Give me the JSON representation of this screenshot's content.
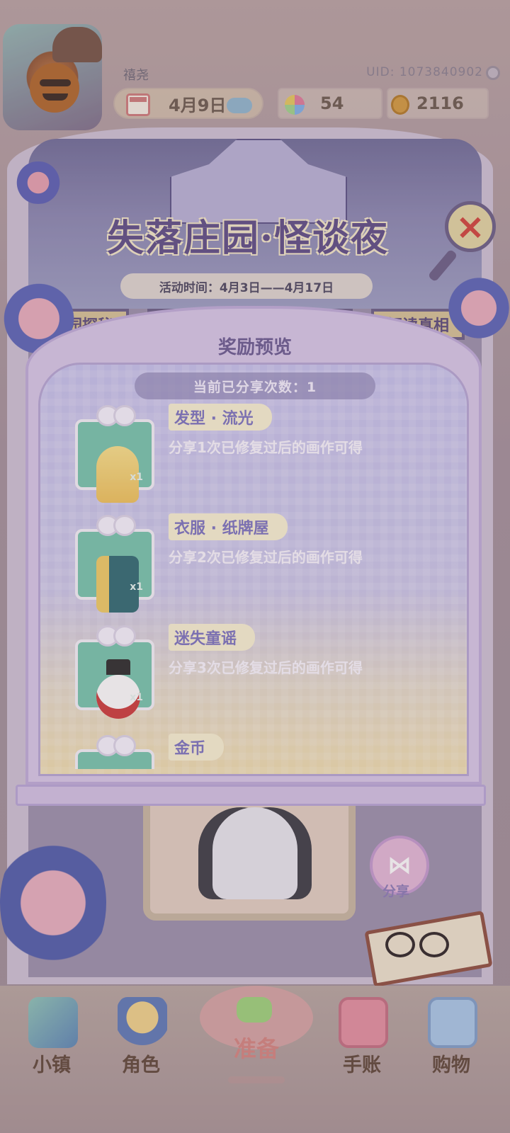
{
  "header": {
    "username": "禧尧",
    "uid": "UID: 1073840902",
    "date": "4月9日",
    "flowers": "54",
    "coins": "2116"
  },
  "event": {
    "title": "失落庄园·怪谈夜",
    "time": "活动时间：4月3日——4月17日",
    "tabs": [
      "庄园探秘",
      "解读真相"
    ]
  },
  "modal": {
    "title": "奖励预览",
    "share_count": "当前已分享次数：1",
    "rewards": [
      {
        "name": "发型 · 流光",
        "desc": "分享1次已修复过后的画作可得",
        "qty": "x1"
      },
      {
        "name": "衣服 · 纸牌屋",
        "desc": "分享2次已修复过后的画作可得",
        "qty": "x1"
      },
      {
        "name": "迷失童谣",
        "desc": "分享3次已修复过后的画作可得",
        "qty": "x1"
      },
      {
        "name": "金币",
        "desc": "",
        "qty": ""
      }
    ]
  },
  "scene": {
    "share_label": "分享"
  },
  "nav": {
    "items": [
      "小镇",
      "角色",
      "准备",
      "手账",
      "购物"
    ]
  },
  "colors": {
    "accent_purple": "#6a5a92",
    "gift_green": "#76c6ae",
    "close_red": "#d2433a"
  }
}
